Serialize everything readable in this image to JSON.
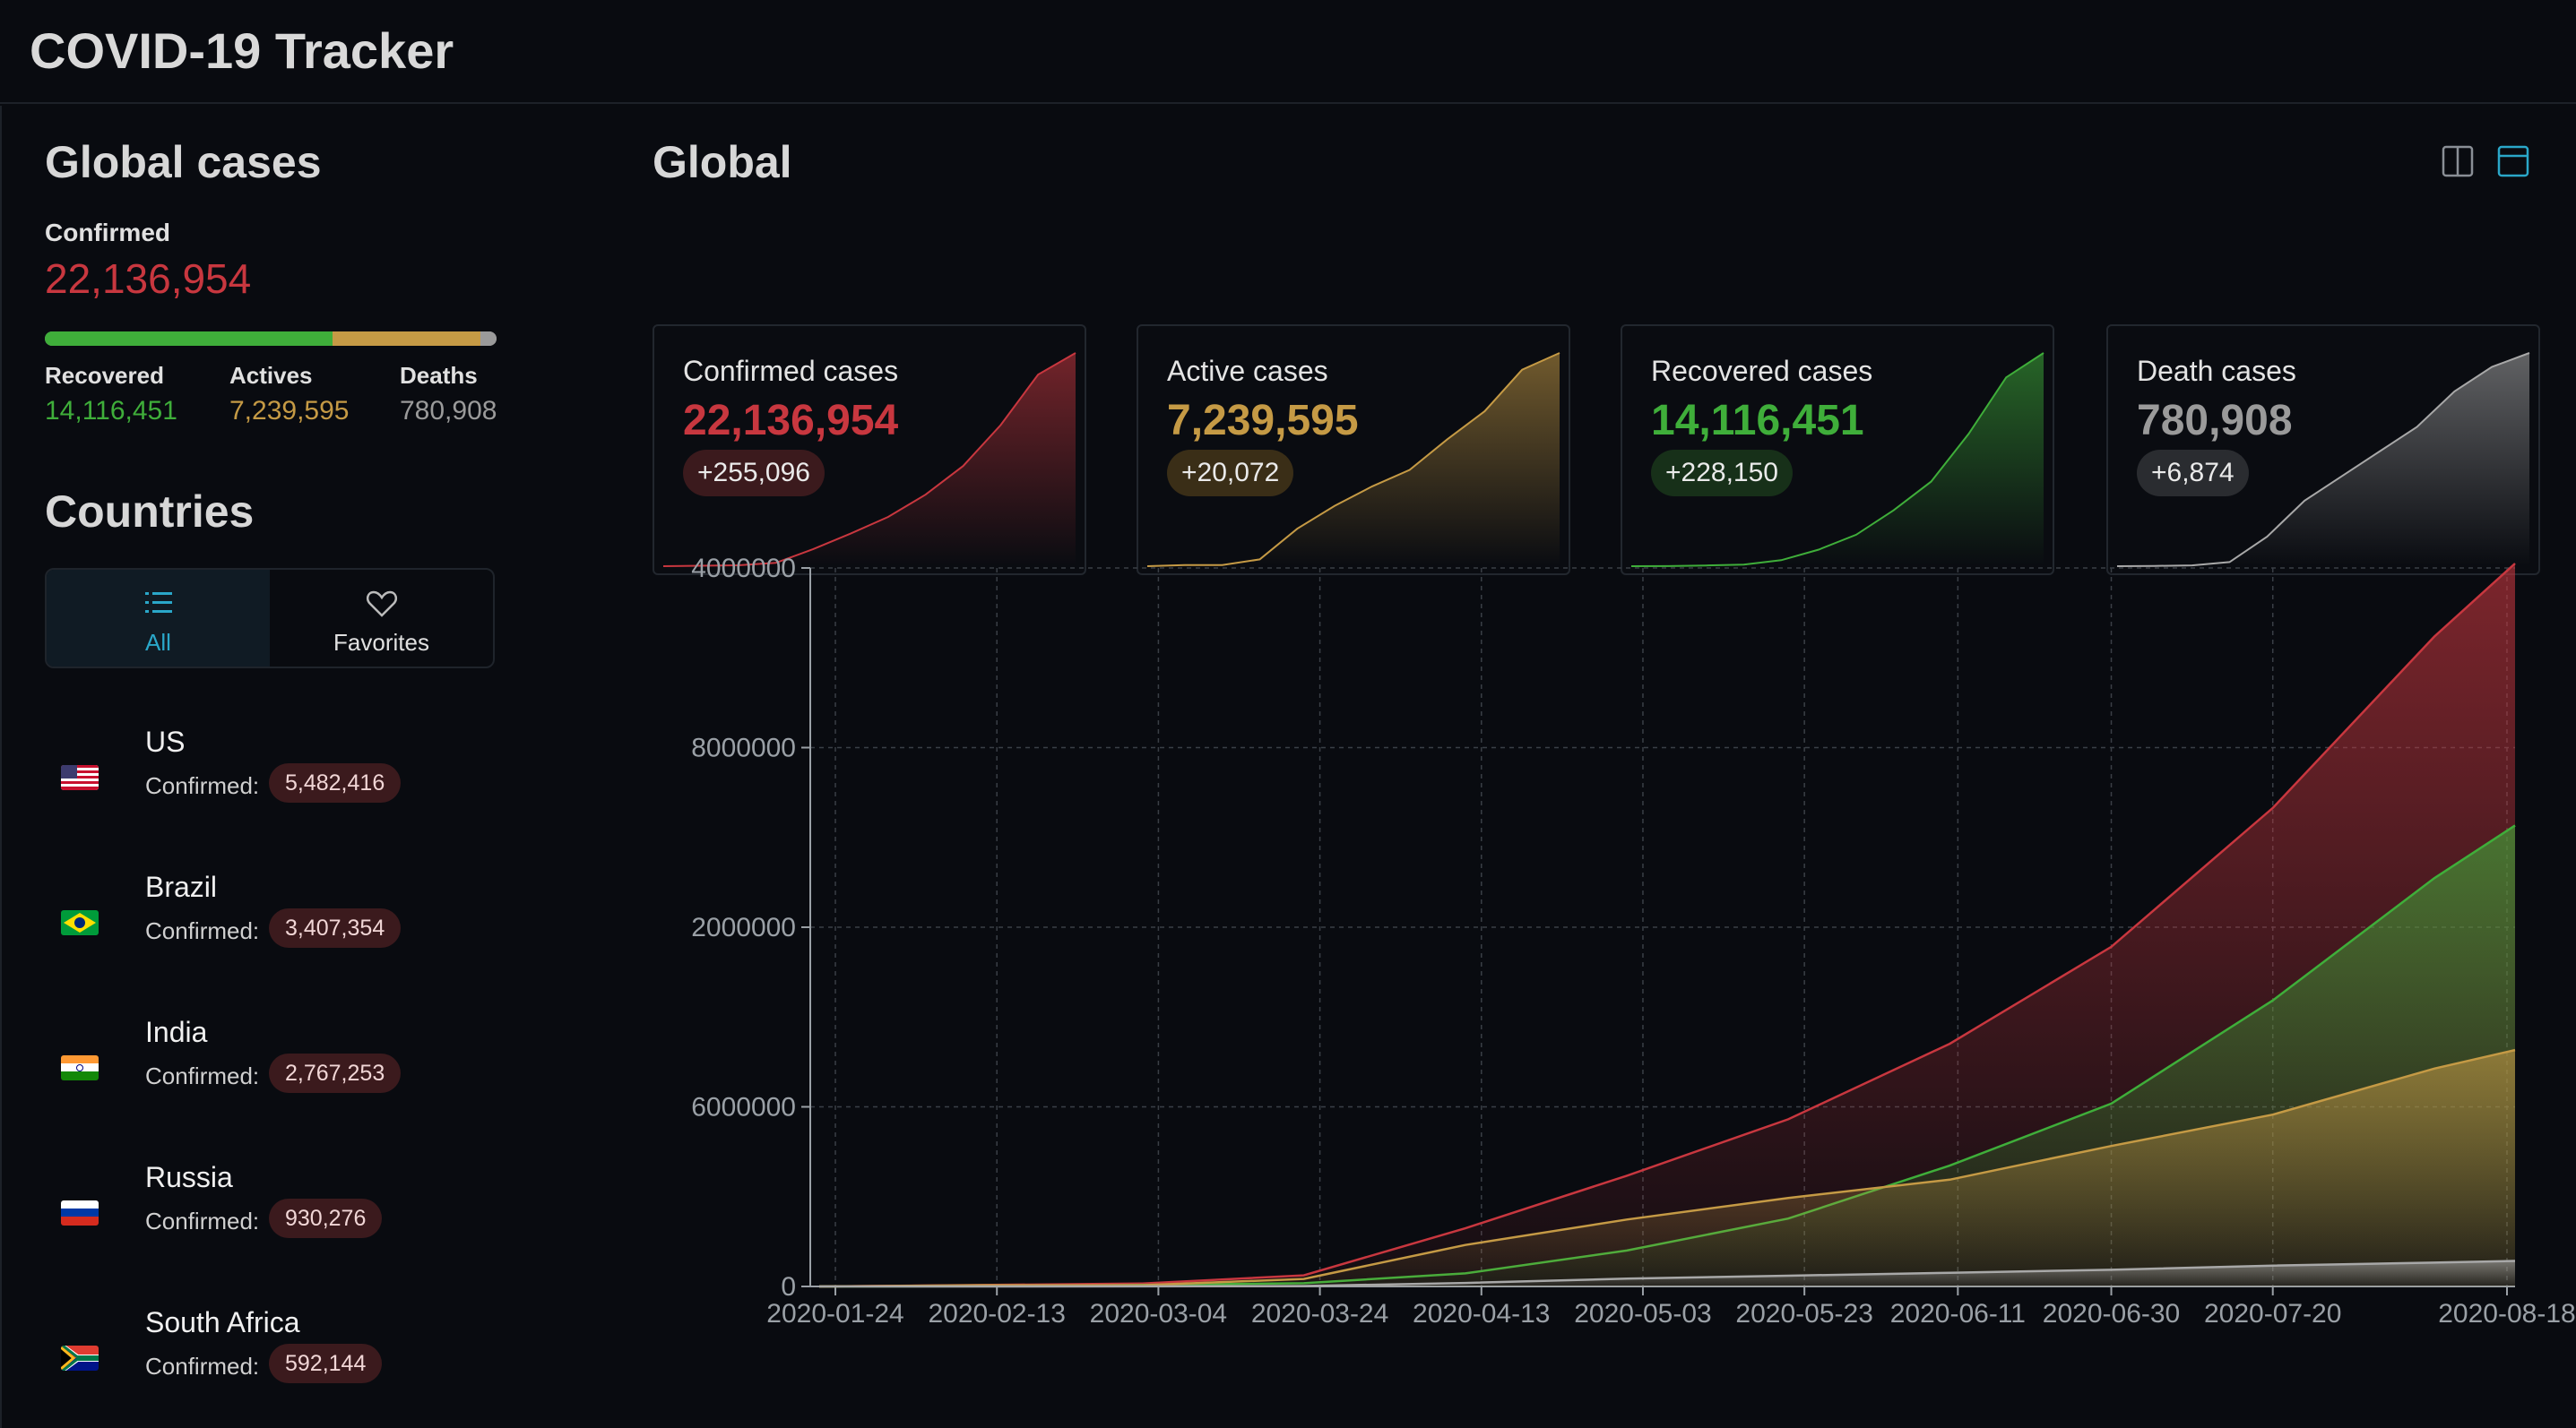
{
  "app": {
    "title": "COVID-19 Tracker"
  },
  "global_cases": {
    "title": "Global cases",
    "confirmed_label": "Confirmed",
    "confirmed_value": "22,136,954",
    "progress": {
      "recovered": 14116451,
      "actives": 7239595,
      "deaths": 780908
    },
    "recovered_label": "Recovered",
    "recovered_value": "14,116,451",
    "actives_label": "Actives",
    "actives_value": "7,239,595",
    "deaths_label": "Deaths",
    "deaths_value": "780,908"
  },
  "countries": {
    "title": "Countries",
    "tabs": [
      {
        "label": "All",
        "icon": "list-icon",
        "active": true
      },
      {
        "label": "Favorites",
        "icon": "heart-icon",
        "active": false
      }
    ],
    "confirmed_label": "Confirmed:",
    "items": [
      {
        "name": "US",
        "confirmed": "5,482,416",
        "flag": "us-flag-icon"
      },
      {
        "name": "Brazil",
        "confirmed": "3,407,354",
        "flag": "brazil-flag-icon"
      },
      {
        "name": "India",
        "confirmed": "2,767,253",
        "flag": "india-flag-icon"
      },
      {
        "name": "Russia",
        "confirmed": "930,276",
        "flag": "russia-flag-icon"
      },
      {
        "name": "South Africa",
        "confirmed": "592,144",
        "flag": "south-africa-flag-icon"
      }
    ]
  },
  "main": {
    "title": "Global",
    "layout_icons": [
      "split-layout-icon",
      "stacked-layout-icon"
    ],
    "cards": [
      {
        "title": "Confirmed cases",
        "value": "22,136,954",
        "delta": "+255,096",
        "color": "#c8373f",
        "badge_bg": "#3b1a1d"
      },
      {
        "title": "Active cases",
        "value": "7,239,595",
        "delta": "+20,072",
        "color": "#c59a45",
        "badge_bg": "#3a2e17"
      },
      {
        "title": "Recovered cases",
        "value": "14,116,451",
        "delta": "+228,150",
        "color": "#3fae3a",
        "badge_bg": "#173019"
      },
      {
        "title": "Death cases",
        "value": "780,908",
        "delta": "+6,874",
        "color": "#9a9a9a",
        "badge_bg": "#2a2c30"
      }
    ]
  },
  "colors": {
    "confirmed": "#c8373f",
    "active": "#c59a45",
    "recovered": "#3fae3a",
    "death": "#a8a8a8",
    "accent": "#2aa7c9"
  },
  "chart_data": {
    "type": "area",
    "title": "",
    "xlabel": "",
    "ylabel": "",
    "grid": true,
    "x_tick_labels": [
      "2020-01-24",
      "2020-02-13",
      "2020-03-04",
      "2020-03-24",
      "2020-04-13",
      "2020-05-03",
      "2020-05-23",
      "2020-06-11",
      "2020-06-30",
      "2020-07-20",
      "2020-08-18"
    ],
    "y_tick_labels": [
      "4000000",
      "8000000",
      "2000000",
      "6000000",
      "0"
    ],
    "ylim": [
      0,
      22000000
    ],
    "x": [
      "2020-01-22",
      "2020-02-11",
      "2020-03-02",
      "2020-03-22",
      "2020-04-11",
      "2020-05-01",
      "2020-05-21",
      "2020-06-10",
      "2020-06-30",
      "2020-07-20",
      "2020-08-09",
      "2020-08-19"
    ],
    "series": [
      {
        "name": "Confirmed",
        "values": [
          500,
          45000,
          90000,
          340000,
          1780000,
          3390000,
          5120000,
          7430000,
          10400000,
          14650000,
          19900000,
          22136954
        ]
      },
      {
        "name": "Recovered",
        "values": [
          30,
          5000,
          48000,
          100000,
          400000,
          1100000,
          2080000,
          3700000,
          5600000,
          8760000,
          12500000,
          14116451
        ]
      },
      {
        "name": "Active",
        "values": [
          470,
          38000,
          39000,
          230000,
          1270000,
          2050000,
          2710000,
          3270000,
          4300000,
          5260000,
          6670000,
          7239595
        ]
      },
      {
        "name": "Deaths",
        "values": [
          17,
          1100,
          3100,
          15000,
          108000,
          240000,
          330000,
          420000,
          510000,
          640000,
          730000,
          780908
        ]
      }
    ]
  }
}
